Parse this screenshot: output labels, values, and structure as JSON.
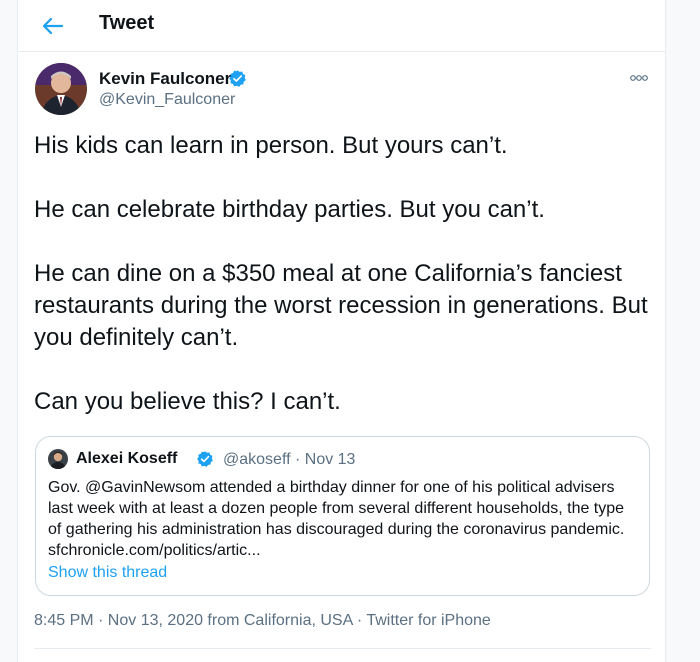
{
  "header": {
    "back_icon": "arrow-left-icon",
    "title": "Tweet"
  },
  "colors": {
    "accent": "#1da1f2",
    "text": "#0f1419",
    "secondary": "#5b7083",
    "border": "#cfd9de"
  },
  "tweet": {
    "author": {
      "name": "Kevin Faulconer",
      "handle": "@Kevin_Faulconer",
      "verified": true
    },
    "more_icon": "more-horizontal-icon",
    "text": {
      "line1": "His kids can learn in person. But yours can’t.",
      "line2": "He can celebrate birthday parties. But you can’t.",
      "line3": "He can dine on a $350 meal at one California’s fanciest restaurants during the worst recession in generations. But you definitely can’t.",
      "line4": "Can you believe this? I can’t."
    },
    "quote": {
      "name": "Alexei Koseff",
      "handle_date": "@akoseff · Nov 13",
      "verified": true,
      "text": "Gov. @GavinNewsom attended a birthday dinner for one of his political advisers last week with at least a dozen people from several different households, the type of gathering his administration has discouraged during the coronavirus pandemic. sfchronicle.com/politics/artic...",
      "show_thread": "Show this thread"
    },
    "meta": {
      "time_date": "8:45 PM · Nov 13, 2020",
      "from": " from ",
      "location": "California, USA",
      "sep": " · ",
      "source": "Twitter for iPhone"
    }
  }
}
